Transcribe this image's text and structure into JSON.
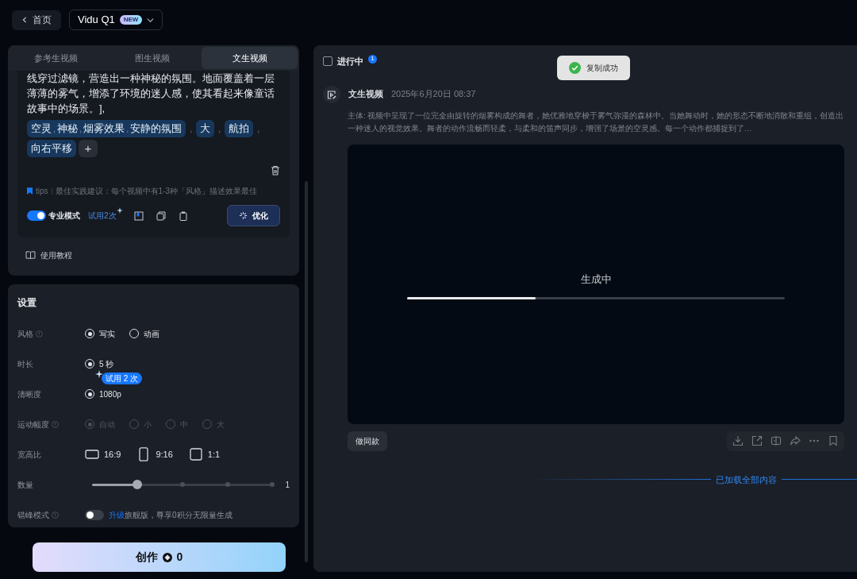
{
  "topbar": {
    "back_label": "首页",
    "model": "Vidu Q1",
    "model_badge": "NEW"
  },
  "tabs": [
    {
      "label": "参考生视频",
      "selected": false
    },
    {
      "label": "图生视频",
      "selected": false
    },
    {
      "label": "文生视频",
      "selected": true
    }
  ],
  "prompt": {
    "text": "线穿过滤镜，营造出一种神秘的氛围。地面覆盖着一层薄薄的雾气，增添了环境的迷人感，使其看起来像童话故事中的场景。],",
    "tag_groups": [
      {
        "tags": [
          "空灵",
          "神秘",
          "烟雾效果",
          "安静的氛围"
        ]
      },
      {
        "tags": [
          "大"
        ]
      },
      {
        "tags": [
          "航拍"
        ]
      },
      {
        "tags": [
          "向右平移"
        ]
      }
    ],
    "separator": ",",
    "add_label": "+",
    "tips_label": "tips",
    "tips_text": "最佳实践建议：每个视频中有1-3种「风格」描述效果最佳",
    "pro_mode": {
      "label": "专业模式",
      "on": true
    },
    "trial": "试用2次",
    "optimize": "优化"
  },
  "tutorial": "使用教程",
  "settings": {
    "title": "设置",
    "rows": [
      {
        "kind": "radio",
        "label": "风格",
        "info": true,
        "disabled": false,
        "options": [
          {
            "label": "写实",
            "selected": true
          },
          {
            "label": "动画",
            "selected": false
          }
        ]
      },
      {
        "kind": "radio",
        "label": "时长",
        "info": false,
        "disabled": false,
        "options": [
          {
            "label": "5 秒",
            "selected": true
          }
        ],
        "bubble": "试用 2 次"
      },
      {
        "kind": "radio",
        "label": "清晰度",
        "info": false,
        "disabled": false,
        "options": [
          {
            "label": "1080p",
            "selected": true
          }
        ]
      },
      {
        "kind": "radio",
        "label": "运动幅度",
        "info": true,
        "disabled": true,
        "options": [
          {
            "label": "自动",
            "selected": true
          },
          {
            "label": "小",
            "selected": false
          },
          {
            "label": "中",
            "selected": false
          },
          {
            "label": "大",
            "selected": false
          }
        ]
      },
      {
        "kind": "aspect",
        "label": "宽高比",
        "info": false,
        "options": [
          {
            "label": "16:9",
            "kind": "wide",
            "selected": false
          },
          {
            "label": "9:16",
            "kind": "tall",
            "selected": false
          },
          {
            "label": "1:1",
            "kind": "square",
            "selected": false
          }
        ]
      },
      {
        "kind": "slider",
        "label": "数量",
        "info": false,
        "level": 0.25,
        "reading": "1"
      },
      {
        "kind": "toggle",
        "label": "错峰模式",
        "info": true,
        "on": false,
        "link": "升级",
        "text": "旗舰版，尊享0积分无限量生成"
      }
    ]
  },
  "create": {
    "label": "创作",
    "cost": "0"
  },
  "task_panel": {
    "filter": {
      "label": "进行中",
      "checked": false,
      "count": "1"
    },
    "toast": "复制成功",
    "task": {
      "type": "文生视频",
      "time": "2025年6月20日 08:37",
      "description": "主体: 视频中呈现了一位完全由旋转的烟雾构成的舞者，她优雅地穿梭于雾气弥漫的森林中。当她舞动时，她的形态不断地消散和重组，创造出一种迷人的视觉效果。舞者的动作流畅而轻柔，与柔和的笛声同步，增强了场景的空灵感。每一个动作都捕捉到了…",
      "status": "生成中",
      "level": 0.34,
      "remix": "做同款"
    },
    "end_note": "已加载全部内容"
  }
}
